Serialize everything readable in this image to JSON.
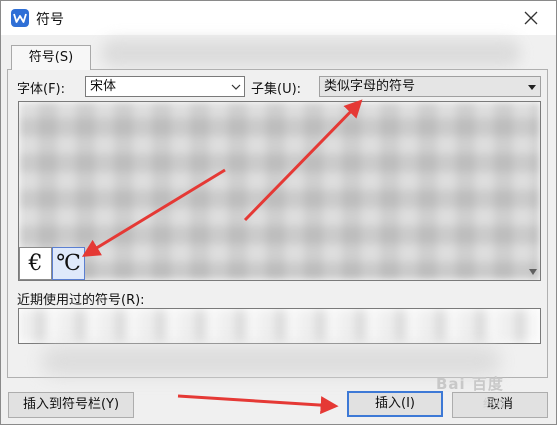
{
  "window": {
    "title": "符号",
    "icon": "wps-writer-icon"
  },
  "tabs": [
    {
      "label": "符号(S)"
    }
  ],
  "font": {
    "label": "字体(F):",
    "value": "宋体"
  },
  "subset": {
    "label": "子集(U):",
    "value": "类似字母的符号"
  },
  "symbols": {
    "visible_cells": [
      "€",
      "℃"
    ]
  },
  "recent": {
    "label": "近期使用过的符号(R):"
  },
  "buttons": {
    "insert_to_bar": "插入到符号栏(Y)",
    "insert": "插入(I)",
    "cancel": "取消"
  },
  "watermark": {
    "brand": "Bai 百度",
    "sub": "经验"
  },
  "colors": {
    "annotation_arrow": "#e53935",
    "focus_border": "#3d79d6"
  }
}
